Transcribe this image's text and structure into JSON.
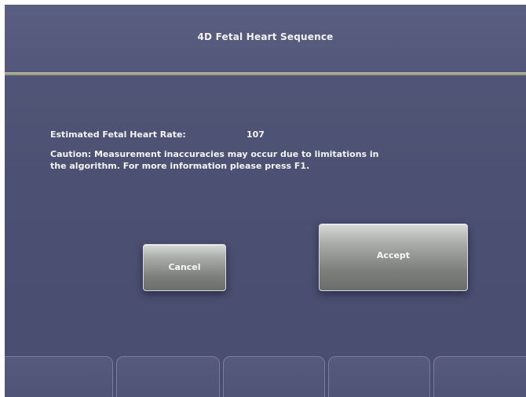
{
  "dialog": {
    "title": "4D Fetal Heart Sequence",
    "rate_label": "Estimated Fetal Heart Rate:",
    "rate_value": "107",
    "caution": "Caution: Measurement inaccuracies may occur due to limitations in the algorithm. For more information please press F1."
  },
  "buttons": {
    "cancel_label": "Cancel",
    "accept_label": "Accept"
  },
  "softkeys": [
    {
      "label": ""
    },
    {
      "label": ""
    },
    {
      "label": ""
    },
    {
      "label": ""
    },
    {
      "label": ""
    }
  ],
  "colors": {
    "background": "#4d5275",
    "divider": "#a9ab97",
    "button_face": "#9c9e9b",
    "text": "#f4f4f6"
  }
}
